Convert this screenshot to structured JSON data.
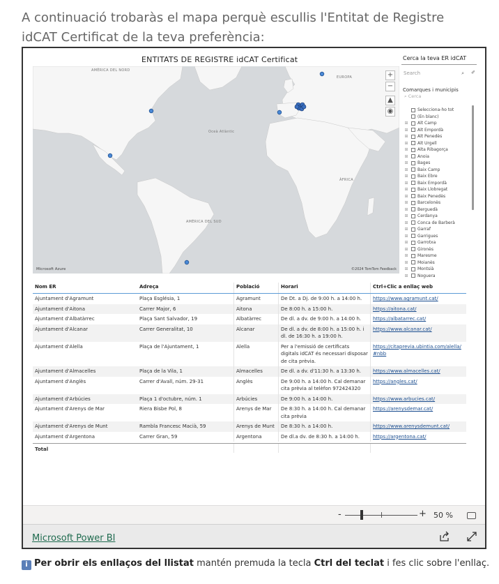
{
  "intro": "A continuació trobaràs el mapa perquè escullis l'Entitat de Registre idCAT Certificat de la teva preferència:",
  "map": {
    "title": "ENTITATS DE REGISTRE idCAT Certificat",
    "labels": {
      "north_america": "AMÈRICA DEL NORD",
      "europe": "EUROPA",
      "atlantic": "Oceà Atlàntic",
      "africa": "ÀFRICA",
      "south_america": "AMÈRICA DEL SUD"
    },
    "credit_left": "Microsoft Azure",
    "credit_right": "©2024 TomTom  Feedback",
    "controls": [
      "+",
      "−",
      "▲",
      "◉"
    ]
  },
  "slicer": {
    "title": "Cerca la teva ER idCAT",
    "search_placeholder": "Search",
    "subtitle": "Comarques i municipis",
    "sub_search": "Cerca",
    "items": [
      "Selecciona-ho tot",
      "(En blanc)",
      "Alt Camp",
      "Alt Empordà",
      "Alt Penedès",
      "Alt Urgell",
      "Alta Ribagorça",
      "Anoia",
      "Bages",
      "Baix Camp",
      "Baix Ebre",
      "Baix Empordà",
      "Baix Llobregat",
      "Baix Penedès",
      "Barcelonès",
      "Berguedà",
      "Cerdanya",
      "Conca de Barberà",
      "Garraf",
      "Garrigues",
      "Garrotxa",
      "Gironès",
      "Maresme",
      "Moianès",
      "Montsià",
      "Noguera"
    ]
  },
  "table": {
    "headers": [
      "Nom ER",
      "Adreça",
      "Població",
      "Horari",
      "Ctrl+Clic a enllaç web"
    ],
    "rows": [
      [
        "Ajuntament d'Agramunt",
        "Plaça Església, 1",
        "Agramunt",
        "De Dt. a Dj. de 9:00 h. a 14:00 h.",
        "https://www.agramunt.cat/"
      ],
      [
        "Ajuntament d'Aitona",
        "Carrer Major, 6",
        "Aitona",
        "De 8:00 h. a 15:00 h.",
        "https://aitona.cat/"
      ],
      [
        "Ajuntament d'Albatàrrec",
        "Plaça Sant Salvador, 19",
        "Albatàrrec",
        "De dl. a dv. de 9:00 h. a 14:00 h.",
        "https://albatarrec.cat/"
      ],
      [
        "Ajuntament d'Alcanar",
        "Carrer Generalitat, 10",
        "Alcanar",
        "De dl. a dv. de 8:00 h. a 15:00 h. i dl. de 16:30 h. a 19:00 h.",
        "https://www.alcanar.cat/"
      ],
      [
        "Ajuntament d'Alella",
        "Plaça de l'Ajuntament, 1",
        "Alella",
        "Per a l'emissió de certificats digitals idCAT és necessari disposar de cita prèvia.",
        "https://citaprevia.ubintia.com/alella/#nbb"
      ],
      [
        "Ajuntament d'Almacelles",
        "Plaça de la Vila, 1",
        "Almacelles",
        "De dl. a dv. d'11:30 h. a 13:30 h.",
        "https://www.almacelles.cat/"
      ],
      [
        "Ajuntament d'Anglès",
        "Carrer d'Avall, núm. 29-31",
        "Anglès",
        "De 9:00 h. a 14:00 h. Cal demanar cita prèvia al telèfon 972424320",
        "https://angles.cat/"
      ],
      [
        "Ajuntament d'Arbúcies",
        "Plaça 1 d'octubre, núm. 1",
        "Arbúcies",
        "De 9:00 h. a 14:00 h.",
        "https://www.arbucies.cat/"
      ],
      [
        "Ajuntament d'Arenys de Mar",
        "Riera Bisbe Pol, 8",
        "Arenys de Mar",
        "De 8:30 h. a 14:00 h. Cal demanar cita prèvia",
        "https://arenysdemar.cat/"
      ],
      [
        "Ajuntament d'Arenys de Munt",
        "Rambla Francesc Macià, 59",
        "Arenys de Munt",
        "De 8:30 h. a 14:00 h.",
        "https://www.arenysdemunt.cat/"
      ],
      [
        "Ajuntament d'Argentona",
        "Carrer Gran, 59",
        "Argentona",
        "De dl.a dv. de 8:30 h. a 14:00 h.",
        "https://argentona.cat/"
      ]
    ],
    "total_label": "Total"
  },
  "zoom": {
    "minus": "-",
    "plus": "+",
    "value": "50 %",
    "level": 0.5
  },
  "footer": {
    "link": "Microsoft Power BI"
  },
  "note": {
    "icon": "i",
    "bold1": "Per obrir els enllaços del llistat",
    "text1": " mantén premuda la tecla ",
    "bold2": "Ctrl del teclat",
    "text2": " i fes clic sobre l'enllaç."
  }
}
